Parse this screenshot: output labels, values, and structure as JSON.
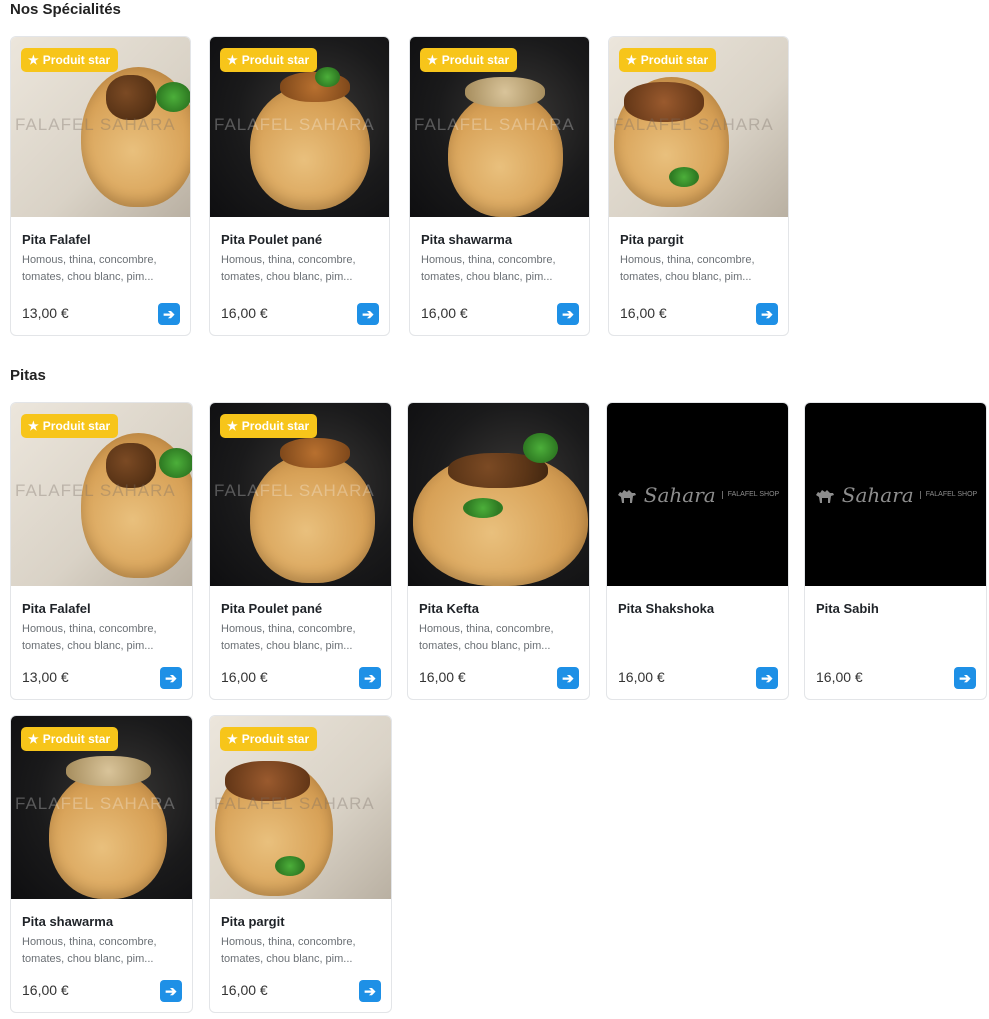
{
  "sections": [
    {
      "title": "Nos Spécialités",
      "items": [
        {
          "name": "Pita Falafel",
          "desc": "Homous, thina, concombre, tomates, chou blanc, pim...",
          "price": "13,00 €",
          "badge": "Produit star"
        },
        {
          "name": "Pita Poulet pané",
          "desc": "Homous, thina, concombre, tomates, chou blanc, pim...",
          "price": "16,00 €",
          "badge": "Produit star"
        },
        {
          "name": "Pita shawarma",
          "desc": "Homous, thina, concombre, tomates, chou blanc, pim...",
          "price": "16,00 €",
          "badge": "Produit star"
        },
        {
          "name": "Pita pargit",
          "desc": "Homous, thina, concombre, tomates, chou blanc, pim...",
          "price": "16,00 €",
          "badge": "Produit star"
        }
      ]
    },
    {
      "title": "Pitas",
      "items": [
        {
          "name": "Pita Falafel",
          "desc": "Homous, thina, concombre, tomates, chou blanc, pim...",
          "price": "13,00 €",
          "badge": "Produit star"
        },
        {
          "name": "Pita Poulet pané",
          "desc": "Homous, thina, concombre, tomates, chou blanc, pim...",
          "price": "16,00 €",
          "badge": "Produit star"
        },
        {
          "name": "Pita Kefta",
          "desc": "Homous, thina, concombre, tomates, chou blanc, pim...",
          "price": "16,00 €"
        },
        {
          "name": "Pita Shakshoka",
          "desc": "",
          "price": "16,00 €"
        },
        {
          "name": "Pita Sabih",
          "desc": "",
          "price": "16,00 €"
        },
        {
          "name": "Pita shawarma",
          "desc": "Homous, thina, concombre, tomates, chou blanc, pim...",
          "price": "16,00 €",
          "badge": "Produit star"
        },
        {
          "name": "Pita pargit",
          "desc": "Homous, thina, concombre, tomates, chou blanc, pim...",
          "price": "16,00 €",
          "badge": "Produit star"
        }
      ]
    }
  ],
  "placeholder_logo": {
    "brand": "Sahara",
    "sub": "FALAFEL SHOP"
  },
  "colors": {
    "badge": "#f7c51a",
    "arrow_button": "#1e90e6"
  },
  "icons": {
    "badge": "star-icon",
    "go": "arrow-right-icon",
    "placeholder": "camel-icon"
  }
}
